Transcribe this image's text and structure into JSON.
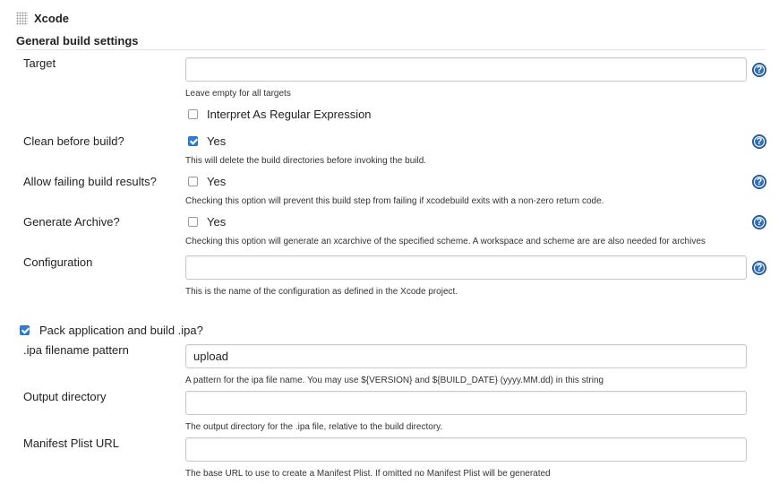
{
  "header": {
    "title": "Xcode",
    "section": "General build settings"
  },
  "fields": {
    "target": {
      "label": "Target",
      "value": "",
      "hint": "Leave empty for all targets"
    },
    "regex": {
      "label": "Interpret As Regular Expression",
      "checked": false
    },
    "clean": {
      "label": "Clean before build?",
      "option": "Yes",
      "checked": true,
      "hint": "This will delete the build directories before invoking the build."
    },
    "allow_failing": {
      "label": "Allow failing build results?",
      "option": "Yes",
      "checked": false,
      "hint": "Checking this option will prevent this build step from failing if xcodebuild exits with a non-zero return code."
    },
    "archive": {
      "label": "Generate Archive?",
      "option": "Yes",
      "checked": false,
      "hint": "Checking this option will generate an xcarchive of the specified scheme. A workspace and scheme are are also needed for archives"
    },
    "configuration": {
      "label": "Configuration",
      "value": "",
      "hint": "This is the name of the configuration as defined in the Xcode project."
    },
    "pack_ipa": {
      "label": "Pack application and build .ipa?",
      "checked": true
    },
    "ipa_pattern": {
      "label": ".ipa filename pattern",
      "value": "upload",
      "hint": "A pattern for the ipa file name. You may use ${VERSION} and ${BUILD_DATE} (yyyy.MM.dd) in this string"
    },
    "output_dir": {
      "label": "Output directory",
      "value": "",
      "hint": "The output directory for the .ipa file, relative to the build directory."
    },
    "manifest_url": {
      "label": "Manifest Plist URL",
      "value": "",
      "hint": "The base URL to use to create a Manifest Plist. If omitted no Manifest Plist will be generated"
    }
  },
  "help_icon": {
    "glyph": "?",
    "color": "#2f6db5"
  },
  "accent": "#2f7fd6"
}
